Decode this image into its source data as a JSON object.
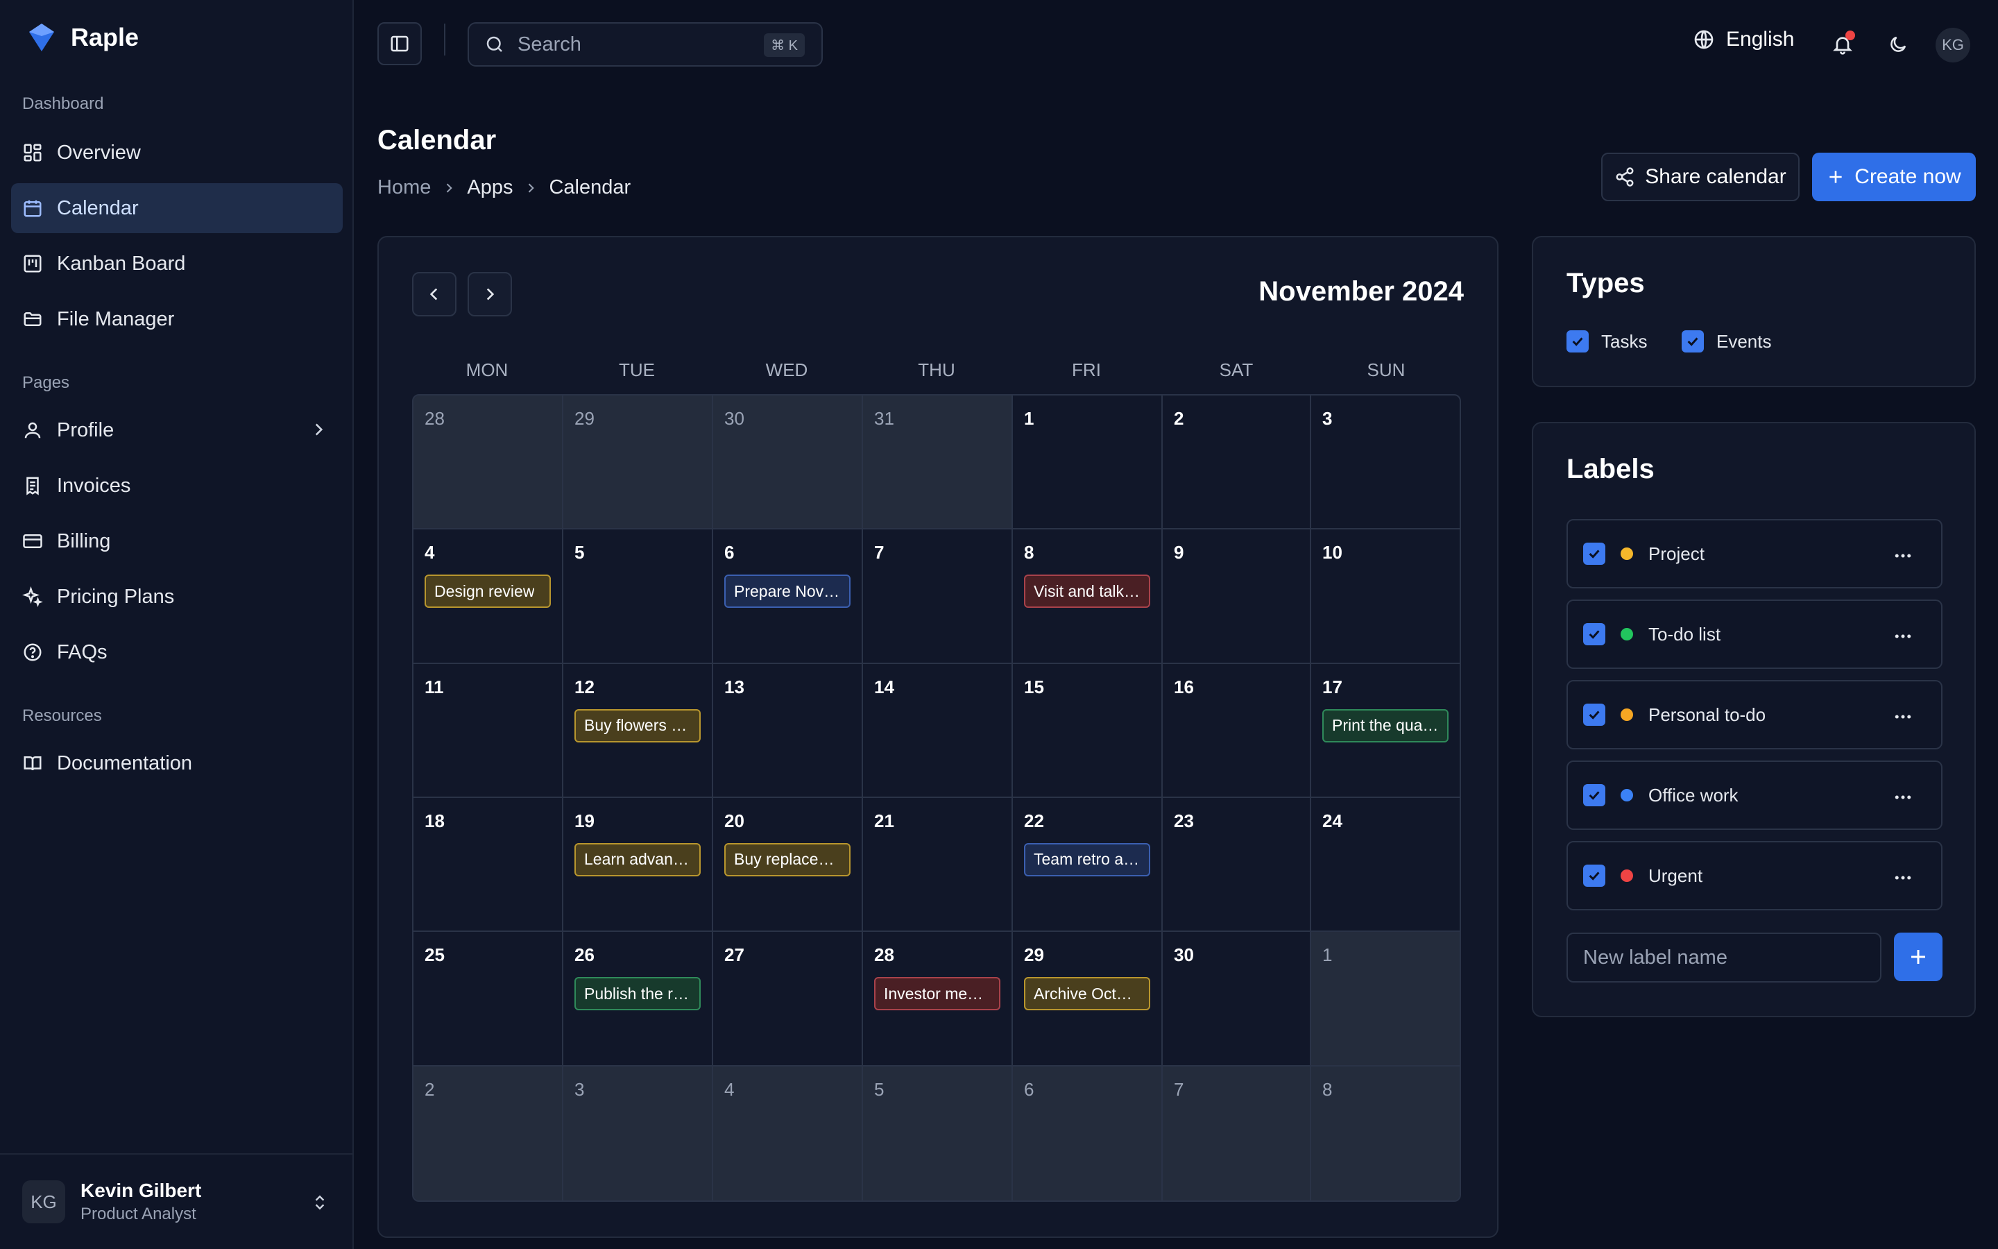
{
  "app": {
    "name": "Raple"
  },
  "sidebar": {
    "sections": [
      {
        "title": "Dashboard",
        "items": [
          {
            "label": "Overview",
            "icon": "grid-icon"
          },
          {
            "label": "Calendar",
            "icon": "calendar-icon",
            "active": true
          },
          {
            "label": "Kanban Board",
            "icon": "kanban-icon"
          },
          {
            "label": "File Manager",
            "icon": "folder-icon"
          }
        ]
      },
      {
        "title": "Pages",
        "items": [
          {
            "label": "Profile",
            "icon": "user-icon",
            "has_submenu": true
          },
          {
            "label": "Invoices",
            "icon": "invoice-icon"
          },
          {
            "label": "Billing",
            "icon": "credit-card-icon"
          },
          {
            "label": "Pricing Plans",
            "icon": "sparkle-icon"
          },
          {
            "label": "FAQs",
            "icon": "help-circle-icon"
          }
        ]
      },
      {
        "title": "Resources",
        "items": [
          {
            "label": "Documentation",
            "icon": "book-icon"
          }
        ]
      }
    ],
    "user": {
      "initials": "KG",
      "name": "Kevin Gilbert",
      "role": "Product Analyst"
    }
  },
  "topbar": {
    "search_placeholder": "Search",
    "search_shortcut": "⌘ K",
    "language": "English",
    "avatar_initials": "KG"
  },
  "page": {
    "title": "Calendar",
    "breadcrumb": [
      "Home",
      "Apps",
      "Calendar"
    ],
    "share_label": "Share calendar",
    "create_label": "Create now"
  },
  "calendar": {
    "month_title": "November 2024",
    "weekdays": [
      "MON",
      "TUE",
      "WED",
      "THU",
      "FRI",
      "SAT",
      "SUN"
    ],
    "weeks": [
      [
        {
          "day": "28",
          "other": true
        },
        {
          "day": "29",
          "other": true
        },
        {
          "day": "30",
          "other": true
        },
        {
          "day": "31",
          "other": true
        },
        {
          "day": "1"
        },
        {
          "day": "2"
        },
        {
          "day": "3"
        }
      ],
      [
        {
          "day": "4",
          "event": "Design review",
          "tone": "yellow"
        },
        {
          "day": "5"
        },
        {
          "day": "6",
          "event": "Prepare November report",
          "tone": "blue"
        },
        {
          "day": "7"
        },
        {
          "day": "8",
          "event": "Visit and talk to client",
          "tone": "red"
        },
        {
          "day": "9"
        },
        {
          "day": "10"
        }
      ],
      [
        {
          "day": "11"
        },
        {
          "day": "12",
          "event": "Buy flowers for mom",
          "tone": "yellow"
        },
        {
          "day": "13"
        },
        {
          "day": "14"
        },
        {
          "day": "15"
        },
        {
          "day": "16"
        },
        {
          "day": "17",
          "event": "Print the quarterly report",
          "tone": "green"
        }
      ],
      [
        {
          "day": "18"
        },
        {
          "day": "19",
          "event": "Learn advanced topics",
          "tone": "yellow"
        },
        {
          "day": "20",
          "event": "Buy replacement parts",
          "tone": "yellow"
        },
        {
          "day": "21"
        },
        {
          "day": "22",
          "event": "Team retro and planning",
          "tone": "blue"
        },
        {
          "day": "23"
        },
        {
          "day": "24"
        }
      ],
      [
        {
          "day": "25"
        },
        {
          "day": "26",
          "event": "Publish the release",
          "tone": "green"
        },
        {
          "day": "27"
        },
        {
          "day": "28",
          "event": "Investor meeting",
          "tone": "red"
        },
        {
          "day": "29",
          "event": "Archive October files",
          "tone": "yellow"
        },
        {
          "day": "30"
        },
        {
          "day": "1",
          "other": true
        }
      ],
      [
        {
          "day": "2",
          "other": true
        },
        {
          "day": "3",
          "other": true
        },
        {
          "day": "4",
          "other": true
        },
        {
          "day": "5",
          "other": true
        },
        {
          "day": "6",
          "other": true
        },
        {
          "day": "7",
          "other": true
        },
        {
          "day": "8",
          "other": true
        }
      ]
    ],
    "event_tones": {
      "yellow": {
        "bg": "#4a3f1d",
        "border": "#b8962e"
      },
      "blue": {
        "bg": "#1c2b4f",
        "border": "#3b5fb0"
      },
      "red": {
        "bg": "#4a1f24",
        "border": "#a8424b"
      },
      "green": {
        "bg": "#173a2c",
        "border": "#2f8a5a"
      }
    }
  },
  "types": {
    "title": "Types",
    "items": [
      {
        "label": "Tasks",
        "checked": true
      },
      {
        "label": "Events",
        "checked": true
      }
    ]
  },
  "labels": {
    "title": "Labels",
    "items": [
      {
        "label": "Project",
        "color": "#f5b72b",
        "checked": true
      },
      {
        "label": "To-do list",
        "color": "#22c55e",
        "checked": true
      },
      {
        "label": "Personal to-do",
        "color": "#f5a623",
        "checked": true
      },
      {
        "label": "Office work",
        "color": "#3b82f6",
        "checked": true
      },
      {
        "label": "Urgent",
        "color": "#ef4444",
        "checked": true
      }
    ],
    "new_label_placeholder": "New label name"
  }
}
